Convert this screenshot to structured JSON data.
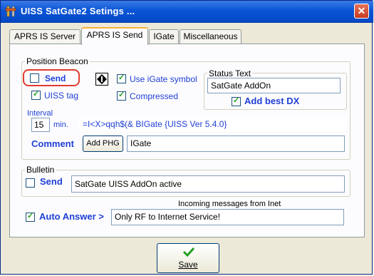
{
  "window": {
    "title": "UISS SatGate2 Setings ...",
    "close_glyph": "✕"
  },
  "tabs": [
    {
      "label": "APRS IS Server",
      "active": false
    },
    {
      "label": "APRS IS Send",
      "active": true
    },
    {
      "label": "IGate",
      "active": false
    },
    {
      "label": "Miscellaneous",
      "active": false
    }
  ],
  "position_beacon": {
    "group_label": "Position Beacon",
    "send_label": "Send",
    "send_checked": false,
    "use_igate_symbol_label": "Use iGate symbol",
    "use_igate_symbol_checked": true,
    "uiss_tag_label": "UISS tag",
    "uiss_tag_checked": true,
    "compressed_label": "Compressed",
    "compressed_checked": true,
    "interval_label": "Interval",
    "interval_value": "15",
    "interval_unit": "min.",
    "beacon_string": "=I<X>qqh$(&  BIGate {UISS Ver 5.4.0}",
    "comment_label": "Comment",
    "add_phg_label": "Add PHG",
    "comment_value": "IGate",
    "symbol_icon": "diamond-symbol-icon"
  },
  "status_text": {
    "group_label": "Status Text",
    "value": "SatGate AddOn",
    "add_best_dx_label": "Add best DX",
    "add_best_dx_checked": true
  },
  "bulletin": {
    "group_label": "Bulletin",
    "send_label": "Send",
    "send_checked": false,
    "value": "SatGate UISS AddOn active"
  },
  "inet": {
    "caption": "Incoming messages from Inet",
    "auto_answer_label": "Auto Answer >",
    "auto_answer_checked": true,
    "value": "Only RF to Internet Service!"
  },
  "save": {
    "label": "Save",
    "icon": "checkmark-icon",
    "accent": "#22a022"
  },
  "colors": {
    "accent_blue": "#1f3fd6",
    "highlight_red": "#e23b2e",
    "titlebar": "#0a55d6"
  }
}
